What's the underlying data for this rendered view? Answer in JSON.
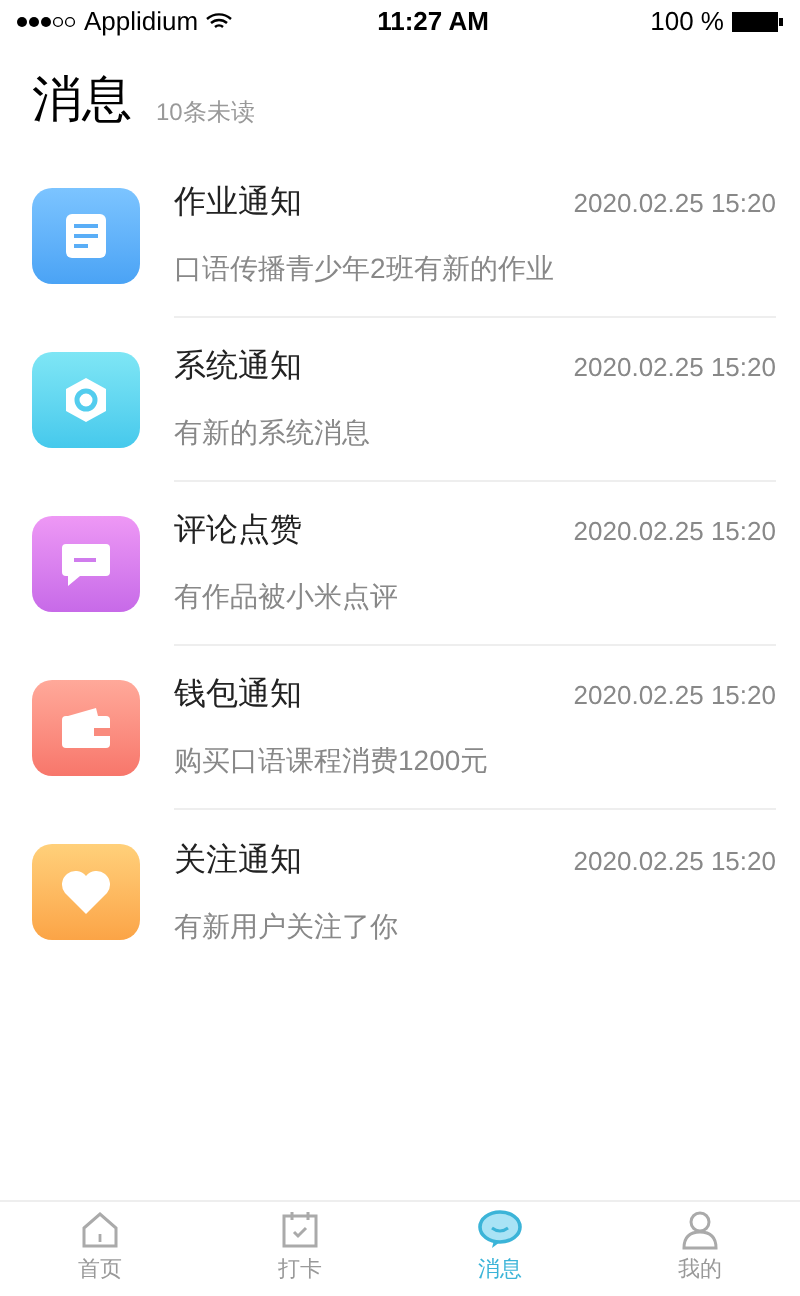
{
  "status_bar": {
    "carrier": "Applidium",
    "time": "11:27 AM",
    "battery": "100 %"
  },
  "header": {
    "title": "消息",
    "unread": "10条未读"
  },
  "messages": [
    {
      "kind": "homework",
      "title": "作业通知",
      "time": "2020.02.25 15:20",
      "preview": "口语传播青少年2班有新的作业"
    },
    {
      "kind": "system",
      "title": "系统通知",
      "time": "2020.02.25 15:20",
      "preview": "有新的系统消息"
    },
    {
      "kind": "comment",
      "title": "评论点赞",
      "time": "2020.02.25 15:20",
      "preview": "有作品被小米点评"
    },
    {
      "kind": "wallet",
      "title": "钱包通知",
      "time": "2020.02.25 15:20",
      "preview": "购买口语课程消费1200元"
    },
    {
      "kind": "follow",
      "title": "关注通知",
      "time": "2020.02.25 15:20",
      "preview": "有新用户关注了你"
    }
  ],
  "tab_bar": [
    {
      "kind": "home",
      "label": "首页",
      "selected": false
    },
    {
      "kind": "checkin",
      "label": "打卡",
      "selected": false
    },
    {
      "kind": "messages",
      "label": "消息",
      "selected": true
    },
    {
      "kind": "profile",
      "label": "我的",
      "selected": false
    }
  ]
}
